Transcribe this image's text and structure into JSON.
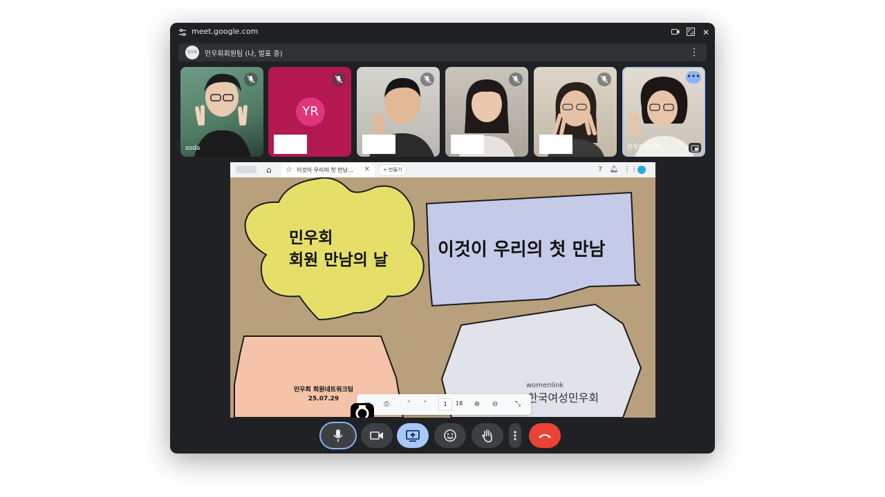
{
  "window": {
    "url": "meet.google.com"
  },
  "meeting": {
    "team_avatar_text": "민우회",
    "title": "민우회회원팀 (나, 발표 중)"
  },
  "participants": [
    {
      "name": "soda",
      "muted": true
    },
    {
      "initials": "YR",
      "muted": true
    },
    {
      "name": "",
      "muted": true
    },
    {
      "name": "",
      "muted": true
    },
    {
      "name": "",
      "muted": true
    },
    {
      "name": "민우회회원팀",
      "muted": false,
      "active": true
    }
  ],
  "browser": {
    "tab_title": "이것이 우리의 첫 만남…",
    "new_button": "만들기"
  },
  "slide": {
    "title_line1": "민우회",
    "title_line2": "회원 만남의 날",
    "headline": "이것이 우리의 첫 만남",
    "footer_line1": "민우회 회원네트워크팀",
    "footer_line2": "25.07.29",
    "brand_en": "womenlink",
    "brand_ko": "한국여성민우회"
  },
  "pdf_toolbar": {
    "page": "1",
    "total": "18"
  },
  "colors": {
    "leave": "#ea4335",
    "present_active": "#a8c7fa",
    "mic_ring": "#8ab4f8"
  }
}
